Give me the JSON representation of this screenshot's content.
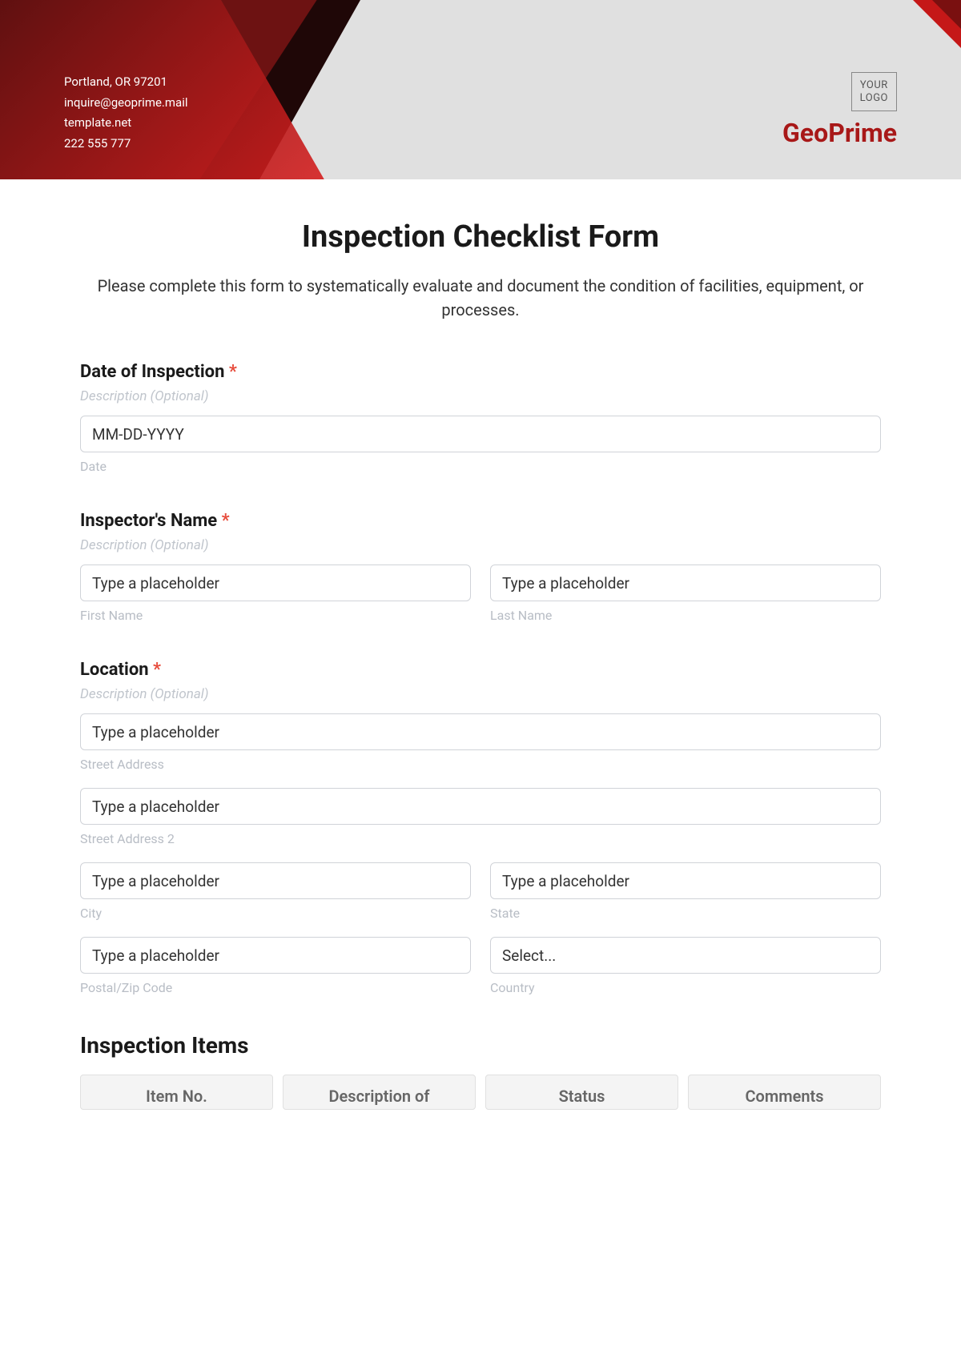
{
  "header": {
    "address": "Portland, OR 97201",
    "email": "inquire@geoprime.mail",
    "website": "template.net",
    "phone": "222 555 777",
    "logo_text": "YOUR\nLOGO",
    "brand": "GeoPrime"
  },
  "form": {
    "title": "Inspection Checklist Form",
    "subtitle": "Please complete this form to systematically evaluate and document the condition of facilities, equipment, or processes.",
    "desc_optional": "Description (Optional)",
    "required_mark": "*",
    "date_field": {
      "label": "Date of Inspection",
      "placeholder": "MM-DD-YYYY",
      "sublabel": "Date"
    },
    "inspector_field": {
      "label": "Inspector's Name",
      "first_placeholder": "Type a placeholder",
      "first_sublabel": "First Name",
      "last_placeholder": "Type a placeholder",
      "last_sublabel": "Last Name"
    },
    "location_field": {
      "label": "Location",
      "street1_placeholder": "Type a placeholder",
      "street1_sublabel": "Street Address",
      "street2_placeholder": "Type a placeholder",
      "street2_sublabel": "Street Address 2",
      "city_placeholder": "Type a placeholder",
      "city_sublabel": "City",
      "state_placeholder": "Type a placeholder",
      "state_sublabel": "State",
      "postal_placeholder": "Type a placeholder",
      "postal_sublabel": "Postal/Zip Code",
      "country_placeholder": "Select...",
      "country_sublabel": "Country"
    },
    "items_section": {
      "title": "Inspection Items",
      "columns": [
        "Item No.",
        "Description of",
        "Status",
        "Comments"
      ]
    }
  }
}
